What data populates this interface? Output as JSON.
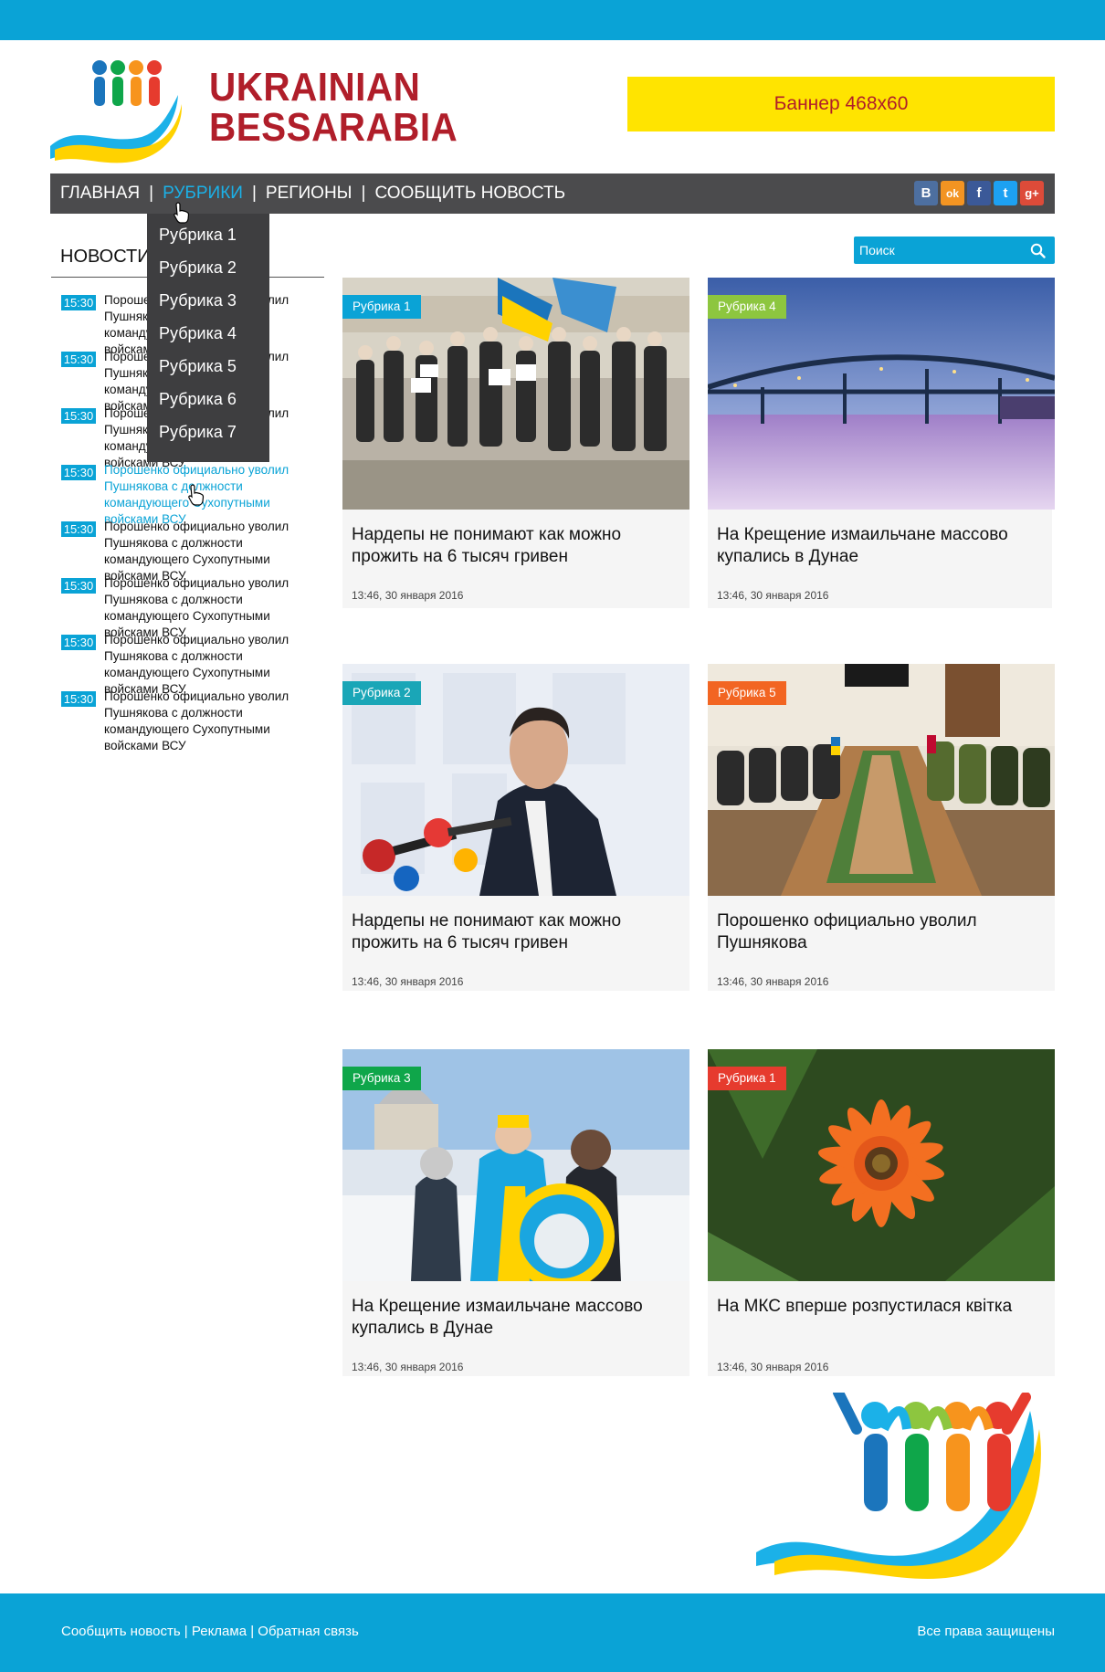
{
  "logo": {
    "line1": "UKRAINIAN",
    "line2": "BESSARABIA"
  },
  "banner": {
    "label": "Баннер 468x60"
  },
  "nav": {
    "items": [
      {
        "label": "ГЛАВНАЯ"
      },
      {
        "label": "РУБРИКИ"
      },
      {
        "label": "РЕГИОНЫ"
      },
      {
        "label": "СООБЩИТЬ НОВОСТЬ"
      }
    ],
    "separator": "|",
    "social": [
      {
        "label": "В",
        "icon": "vk-icon",
        "color": "#4d6fa0"
      },
      {
        "label": "ok",
        "icon": "odnoklassniki-icon",
        "color": "#f39422"
      },
      {
        "label": "f",
        "icon": "facebook-icon",
        "color": "#3b5998"
      },
      {
        "label": "t",
        "icon": "twitter-icon",
        "color": "#1da1f2"
      },
      {
        "label": "g+",
        "icon": "googleplus-icon",
        "color": "#dd4b39"
      }
    ]
  },
  "dropdown": {
    "items": [
      "Рубрика 1",
      "Рубрика 2",
      "Рубрика 3",
      "Рубрика 4",
      "Рубрика 5",
      "Рубрика 6",
      "Рубрика 7"
    ]
  },
  "sidebar": {
    "title": "НОВОСТИ",
    "news": [
      {
        "time": "15:30",
        "text": "Порошенко официально уволил Пушнякова с должности командующего Сухопутными войсками ВСУ"
      },
      {
        "time": "15:30",
        "text": "Порошенко официально уволил Пушнякова с должности командующего Сухопутными войсками ВСУ"
      },
      {
        "time": "15:30",
        "text": "Порошенко официально уволил Пушнякова с должности командующего Сухопутными войсками ВСУ"
      },
      {
        "time": "15:30",
        "text": "Порошенко официально уволил Пушнякова с должности командующего Сухопутными войсками ВСУ"
      },
      {
        "time": "15:30",
        "text": "Порошенко официально уволил Пушнякова с должности командующего Сухопутными войсками ВСУ"
      },
      {
        "time": "15:30",
        "text": "Порошенко официально уволил Пушнякова с должности командующего Сухопутными войсками ВСУ"
      },
      {
        "time": "15:30",
        "text": "Порошенко официально уволил Пушнякова с должности командующего Сухопутными войсками ВСУ"
      },
      {
        "time": "15:30",
        "text": "Порошенко официально уволил Пушнякова с должности командующего Сухопутными войсками ВСУ"
      }
    ]
  },
  "search": {
    "placeholder": "Поиск"
  },
  "cards": [
    {
      "tag": "Рубрика 1",
      "tag_color": "#0aa3d6",
      "title": "Нардепы не понимают как можно прожить на 6 тысяч гривен",
      "date": "13:46, 30 января 2016",
      "image": "protest-crowd-photo"
    },
    {
      "tag": "Рубрика 4",
      "tag_color": "#8dc63f",
      "title": "На Крещение измаильчане массово купались в Дунае",
      "date": "13:46, 30 января 2016",
      "image": "bridge-winter-photo"
    },
    {
      "tag": "Рубрика 2",
      "tag_color": "#1aa6b7",
      "title": "Нардепы не понимают как можно прожить на 6 тысяч гривен",
      "date": "13:46, 30 января 2016",
      "image": "press-conference-photo"
    },
    {
      "tag": "Рубрика 5",
      "tag_color": "#f26522",
      "title": "Порошенко официально уволил Пушнякова",
      "date": "13:46, 30 января 2016",
      "image": "meeting-table-photo"
    },
    {
      "tag": "Рубрика 3",
      "tag_color": "#0fa64a",
      "title": "На Крещение измаильчане массово купались в Дунае",
      "date": "13:46, 30 января 2016",
      "image": "winter-swimmers-photo"
    },
    {
      "tag": "Рубрика 1",
      "tag_color": "#e63b2e",
      "title": "На МКС вперше розпустилася квітка",
      "date": "13:46, 30 января 2016",
      "image": "orange-flower-photo"
    }
  ],
  "footer": {
    "links": [
      "Сообщить новость",
      "Реклама",
      "Обратная связь"
    ],
    "separator": " | ",
    "rights": "Все права защищены"
  },
  "colors": {
    "accent": "#0aa3d6",
    "brand_red": "#b01e2a",
    "banner_yellow": "#ffe400",
    "nav_bg": "#4b4b4d"
  }
}
